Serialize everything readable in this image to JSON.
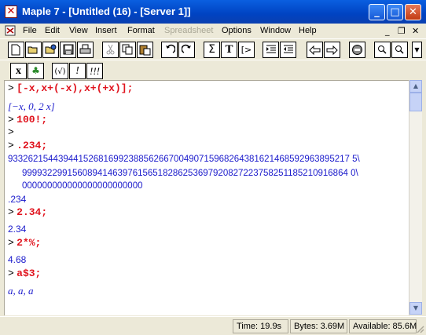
{
  "window": {
    "title": "Maple 7  - [Untitled (16) - [Server 1]]",
    "app_icon_glyph": "✕",
    "minimize_glyph": "_",
    "maximize_glyph": "□",
    "close_glyph": "✕"
  },
  "menu": {
    "items": [
      "File",
      "Edit",
      "View",
      "Insert",
      "Format",
      "Spreadsheet",
      "Options",
      "Window",
      "Help"
    ],
    "disabled": [
      "Spreadsheet"
    ],
    "mdi_minimize": "_",
    "mdi_restore": "❐",
    "mdi_close": "✕"
  },
  "toolbar": {
    "icons": [
      "new-icon",
      "open-icon",
      "open-url-icon",
      "save-icon",
      "print-icon",
      "cut-icon",
      "copy-icon",
      "paste-icon",
      "undo-icon",
      "redo-icon",
      "sum-icon",
      "text-icon",
      "prompt-icon",
      "indent-icon",
      "outdent-icon",
      "back-icon",
      "forward-icon",
      "stop-icon",
      "zoom-in-icon",
      "zoom-out-icon"
    ],
    "glyphs": {
      "sum": "Σ",
      "text": "T",
      "prompt": "[>"
    }
  },
  "toolbar2": {
    "labels": [
      "x",
      "♣",
      "(√)",
      "!",
      "!!!"
    ]
  },
  "worksheet": {
    "prompt": ">",
    "lines": [
      {
        "kind": "input",
        "text": "[-x,x+(-x),x+(+x)];"
      },
      {
        "kind": "output_math",
        "text": "[−x, 0, 2 x]"
      },
      {
        "kind": "input",
        "text": "100!;"
      },
      {
        "kind": "empty_prompt",
        "text": ""
      },
      {
        "kind": "input",
        "text": ".234;"
      },
      {
        "kind": "bignum1",
        "text": "93326215443944152681699238856266700490715968264381621468592963895217 5\\"
      },
      {
        "kind": "bignum2",
        "text": "99993229915608941463976156518286253697920827223758251185210916864 0\\"
      },
      {
        "kind": "bignum3",
        "text": "000000000000000000000000"
      },
      {
        "kind": "output",
        "text": ".234"
      },
      {
        "kind": "input",
        "text": "2.34;"
      },
      {
        "kind": "output",
        "text": "2.34"
      },
      {
        "kind": "input",
        "text": "2*%;"
      },
      {
        "kind": "output",
        "text": "4.68"
      },
      {
        "kind": "input",
        "text": "a$3;"
      },
      {
        "kind": "output_math",
        "text": "a, a, a"
      }
    ]
  },
  "status": {
    "time": "Time:  19.9s",
    "bytes": "Bytes: 3.69M",
    "available": "Available: 85.6M"
  }
}
